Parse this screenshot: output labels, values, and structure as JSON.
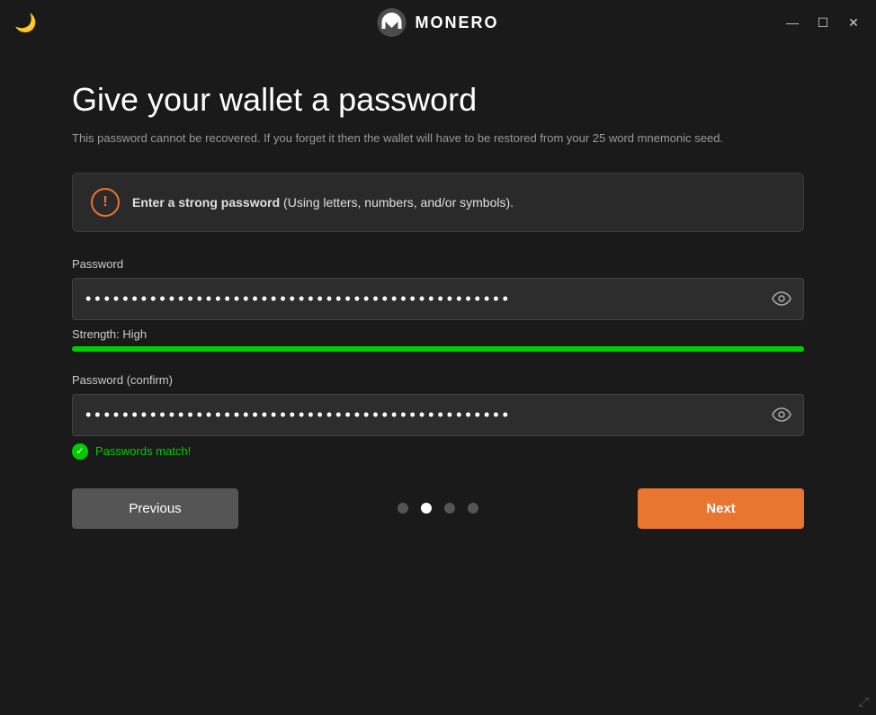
{
  "titlebar": {
    "app_name": "MONERO",
    "minimize_label": "—",
    "maximize_label": "☐",
    "close_label": "✕"
  },
  "page": {
    "title": "Give your wallet a password",
    "subtitle": "This password cannot be recovered. If you forget it then the wallet will have to be restored from your 25 word mnemonic seed."
  },
  "warning": {
    "icon_label": "!",
    "text_bold": "Enter a strong password",
    "text_rest": " (Using letters, numbers, and/or symbols)."
  },
  "password_field": {
    "label": "Password",
    "value": "••••••••••••••••••••••••••••••••••••••••••••••",
    "placeholder": ""
  },
  "strength": {
    "label": "Strength: High",
    "fill_percent": 100,
    "color": "#00cc00"
  },
  "confirm_field": {
    "label": "Password (confirm)",
    "value": "••••••••••••••••••••••••••••••••••••••••••••••|",
    "placeholder": ""
  },
  "match_message": "Passwords match!",
  "nav": {
    "previous_label": "Previous",
    "next_label": "Next",
    "dots": [
      {
        "active": false
      },
      {
        "active": true
      },
      {
        "active": false
      },
      {
        "active": false
      }
    ]
  }
}
